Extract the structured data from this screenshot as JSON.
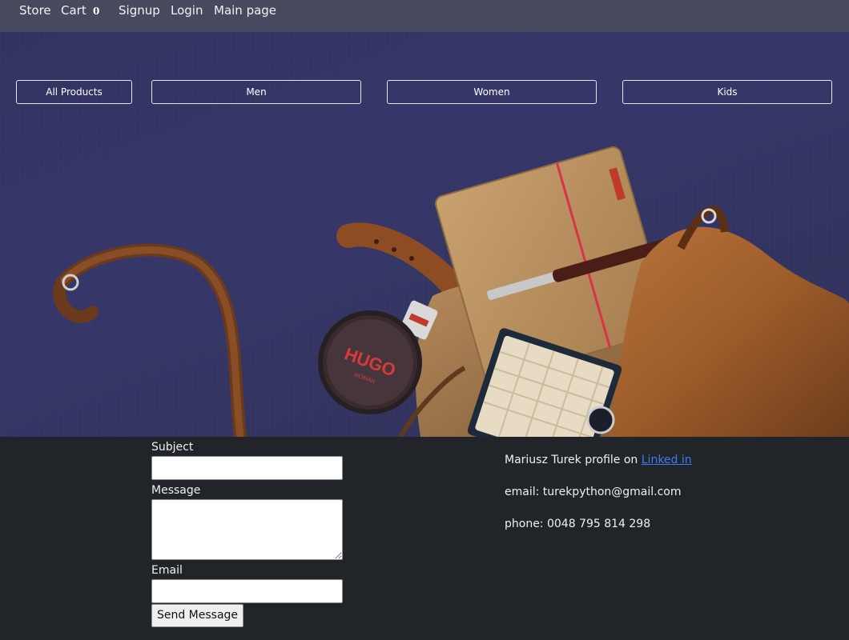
{
  "nav": {
    "store": "Store",
    "cart": "Cart",
    "cart_count": "0",
    "signup": "Signup",
    "login": "Login",
    "main_page": "Main page"
  },
  "categories": {
    "all": "All Products",
    "men": "Men",
    "women": "Women",
    "kids": "Kids"
  },
  "hero": {
    "perfume_brand": "HUGO",
    "perfume_sub": "WOMAN"
  },
  "contact_form": {
    "subject_label": "Subject",
    "subject_value": "",
    "message_label": "Message",
    "message_value": "",
    "email_label": "Email",
    "email_value": "",
    "send_label": "Send Message"
  },
  "info": {
    "profile_prefix": "Mariusz Turek profile on ",
    "profile_link": "Linked in",
    "email": "email: turekpython@gmail.com",
    "phone": "phone: 0048 795 814 298"
  },
  "colors": {
    "navbar": "#474a5e",
    "hero_background": "#3b3c72",
    "footer": "#212429",
    "link": "#3b7df0"
  }
}
